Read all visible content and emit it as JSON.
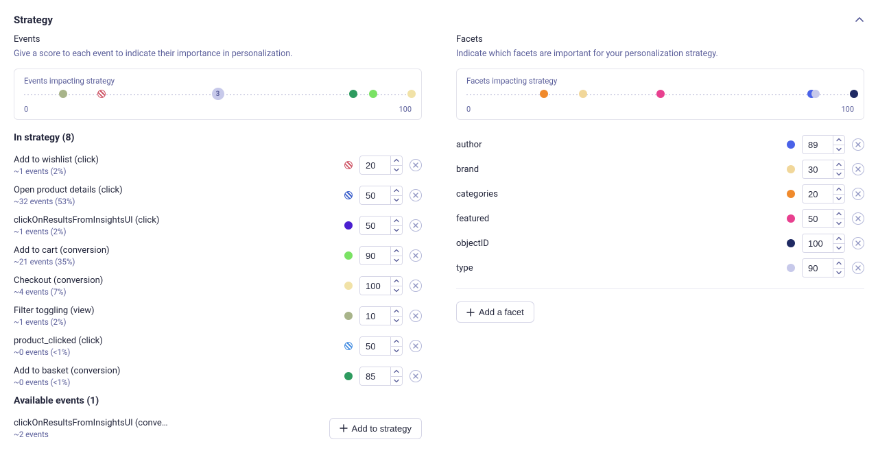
{
  "title": "Strategy",
  "events": {
    "heading": "Events",
    "desc": "Give a score to each event to indicate their importance in personalization.",
    "scale_title": "Events impacting strategy",
    "scale_min": "0",
    "scale_max": "100",
    "cluster_count": "3",
    "in_strategy_heading": "In strategy (8)",
    "items": [
      {
        "name": "Add to wishlist (click)",
        "sub": "~1 events (2%)",
        "value": "20",
        "color": "#d05b6b",
        "hatched": true
      },
      {
        "name": "Open product details (click)",
        "sub": "~32 events (53%)",
        "value": "50",
        "color": "#3b5fcb",
        "hatched": true
      },
      {
        "name": "clickOnResultsFromInsightsUI (click)",
        "sub": "~1 events (2%)",
        "value": "50",
        "color": "#4a1fd0",
        "hatched": false
      },
      {
        "name": "Add to cart (conversion)",
        "sub": "~21 events (35%)",
        "value": "90",
        "color": "#7ae264",
        "hatched": false
      },
      {
        "name": "Checkout (conversion)",
        "sub": "~4 events (7%)",
        "value": "100",
        "color": "#f1e2a7",
        "hatched": false
      },
      {
        "name": "Filter toggling (view)",
        "sub": "~1 events (2%)",
        "value": "10",
        "color": "#a8b48a",
        "hatched": false
      },
      {
        "name": "product_clicked (click)",
        "sub": "~0 events (<1%)",
        "value": "50",
        "color": "#4a90e2",
        "hatched": true
      },
      {
        "name": "Add to basket (conversion)",
        "sub": "~0 events (<1%)",
        "value": "85",
        "color": "#2e9b5f",
        "hatched": false
      }
    ],
    "available_heading": "Available events (1)",
    "available": [
      {
        "name": "clickOnResultsFromInsightsUI (conve…",
        "sub": "~2 events"
      }
    ],
    "add_to_strategy_label": "Add to strategy"
  },
  "facets": {
    "heading": "Facets",
    "desc": "Indicate which facets are important for your personalization strategy.",
    "scale_title": "Facets impacting strategy",
    "scale_min": "0",
    "scale_max": "100",
    "items": [
      {
        "name": "author",
        "value": "89",
        "color": "#4a62e8"
      },
      {
        "name": "brand",
        "value": "30",
        "color": "#f1d79a"
      },
      {
        "name": "categories",
        "value": "20",
        "color": "#f08a2c"
      },
      {
        "name": "featured",
        "value": "50",
        "color": "#e8408f"
      },
      {
        "name": "objectID",
        "value": "100",
        "color": "#1f2a63"
      },
      {
        "name": "type",
        "value": "90",
        "color": "#c7c9ea"
      }
    ],
    "add_facet_label": "Add a facet"
  },
  "chart_data": [
    {
      "type": "scatter",
      "title": "Events impacting strategy",
      "xlabel": "",
      "ylabel": "",
      "xlim": [
        0,
        100
      ],
      "series": [
        {
          "name": "Filter toggling (view)",
          "x": [
            10
          ]
        },
        {
          "name": "Add to wishlist (click)",
          "x": [
            20
          ]
        },
        {
          "name": "Open product details / clickOnResults / product_clicked (cluster)",
          "x": [
            50
          ],
          "count": 3
        },
        {
          "name": "Add to basket (conversion)",
          "x": [
            85
          ]
        },
        {
          "name": "Add to cart (conversion)",
          "x": [
            90
          ]
        },
        {
          "name": "Checkout (conversion)",
          "x": [
            100
          ]
        }
      ]
    },
    {
      "type": "scatter",
      "title": "Facets impacting strategy",
      "xlabel": "",
      "ylabel": "",
      "xlim": [
        0,
        100
      ],
      "series": [
        {
          "name": "categories",
          "x": [
            20
          ]
        },
        {
          "name": "brand",
          "x": [
            30
          ]
        },
        {
          "name": "featured",
          "x": [
            50
          ]
        },
        {
          "name": "author",
          "x": [
            89
          ]
        },
        {
          "name": "type",
          "x": [
            90
          ]
        },
        {
          "name": "objectID",
          "x": [
            100
          ]
        }
      ]
    }
  ]
}
